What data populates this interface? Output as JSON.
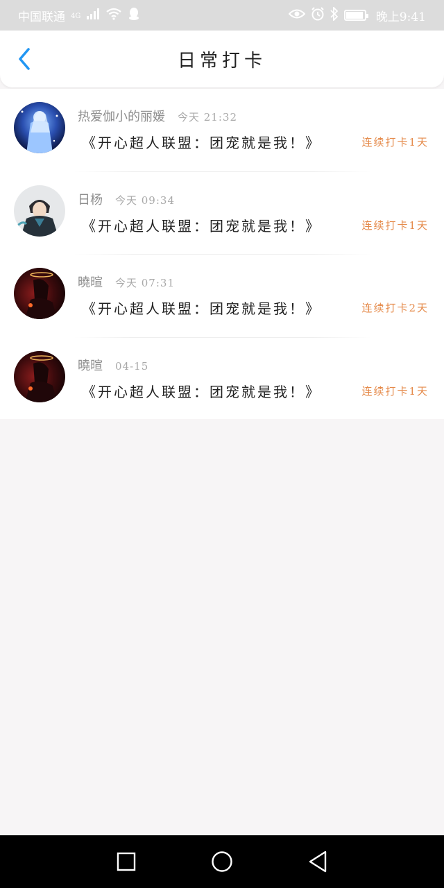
{
  "status_bar": {
    "carrier": "中国联通",
    "network": "4G",
    "time": "晚上9:41",
    "icons": [
      "signal-icon",
      "wifi-icon",
      "qq-icon",
      "eye-icon",
      "alarm-icon",
      "bluetooth-icon",
      "battery-icon"
    ]
  },
  "header": {
    "title": "日常打卡",
    "back_icon": "chevron-left-icon"
  },
  "checkins": [
    {
      "name": "热爱伽小的丽媛",
      "time": "今天 21:32",
      "message": "《开心超人联盟：团宠就是我！》",
      "streak": "连续打卡1天"
    },
    {
      "name": "日杨",
      "time": "今天 09:34",
      "message": "《开心超人联盟：团宠就是我！》",
      "streak": "连续打卡1天"
    },
    {
      "name": "曉暄",
      "time": "今天 07:31",
      "message": "《开心超人联盟：团宠就是我！》",
      "streak": "连续打卡2天"
    },
    {
      "name": "曉暄",
      "time": "04-15",
      "message": "《开心超人联盟：团宠就是我！》",
      "streak": "连续打卡1天"
    }
  ],
  "colors": {
    "accent_blue": "#2196f3",
    "streak_orange": "#e58a4a",
    "background": "#f7f5f6"
  },
  "nav_bar": {
    "icons": [
      "recent-apps-icon",
      "home-icon",
      "back-icon"
    ]
  }
}
